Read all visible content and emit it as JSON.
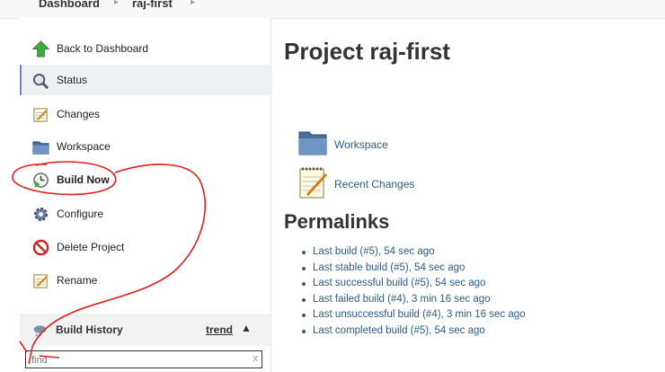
{
  "breadcrumb": {
    "dashboard": "Dashboard",
    "project": "raj-first"
  },
  "sidebar": {
    "items": [
      {
        "label": "Back to Dashboard",
        "icon": "up-arrow-icon"
      },
      {
        "label": "Status",
        "icon": "magnifier-icon"
      },
      {
        "label": "Changes",
        "icon": "notepad-icon"
      },
      {
        "label": "Workspace",
        "icon": "folder-icon"
      },
      {
        "label": "Build Now",
        "icon": "clock-play-icon"
      },
      {
        "label": "Configure",
        "icon": "gear-icon"
      },
      {
        "label": "Delete Project",
        "icon": "no-entry-icon"
      },
      {
        "label": "Rename",
        "icon": "notepad-icon"
      }
    ]
  },
  "build_history": {
    "title": "Build History",
    "trend": "trend",
    "filter_value": "find",
    "clear": "x"
  },
  "main": {
    "title": "Project raj-first",
    "links": [
      {
        "label": "Workspace",
        "icon": "folder-icon"
      },
      {
        "label": "Recent Changes",
        "icon": "notepad-icon"
      }
    ],
    "permalinks_title": "Permalinks",
    "permalinks": [
      "Last build (#5), 54 sec ago",
      "Last stable build (#5), 54 sec ago",
      "Last successful build (#5), 54 sec ago",
      "Last failed build (#4), 3 min 16 sec ago",
      "Last unsuccessful build (#4), 3 min 16 sec ago",
      "Last completed build (#5), 54 sec ago"
    ]
  },
  "colors": {
    "link": "#2d5c8a",
    "annotation": "#e0201a",
    "active_bg": "#edf1f4"
  }
}
